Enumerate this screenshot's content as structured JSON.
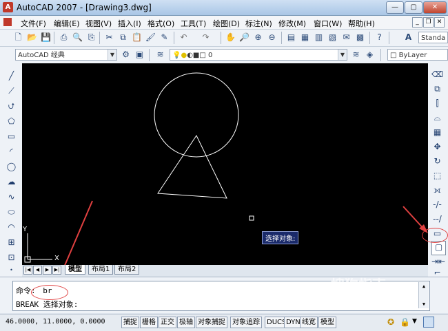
{
  "window": {
    "title": "AutoCAD 2007 - [Drawing3.dwg]"
  },
  "menu": [
    "文件(F)",
    "编辑(E)",
    "视图(V)",
    "插入(I)",
    "格式(O)",
    "工具(T)",
    "绘图(D)",
    "标注(N)",
    "修改(M)",
    "窗口(W)",
    "帮助(H)"
  ],
  "toolbar": {
    "text_style": "Standa"
  },
  "props": {
    "workspace": "AutoCAD 经典",
    "layer": "0",
    "color": "ByLayer"
  },
  "canvas": {
    "tooltip": "选择对象:",
    "ucs_x": "X",
    "ucs_y": "Y"
  },
  "tabs": [
    "模型",
    "布局1",
    "布局2"
  ],
  "command": {
    "prompt": "命令:",
    "input": "br",
    "history": "BREAK 选择对象:"
  },
  "status": {
    "coords": "46.0000, 11.0000, 0.0000",
    "buttons": [
      "捕捉",
      "栅格",
      "正交",
      "极轴",
      "对象捕捉",
      "对象追踪",
      "DUCS",
      "DYN",
      "线宽",
      "模型"
    ]
  },
  "annotation_color": "#e04040",
  "watermark": "搜狗指南"
}
